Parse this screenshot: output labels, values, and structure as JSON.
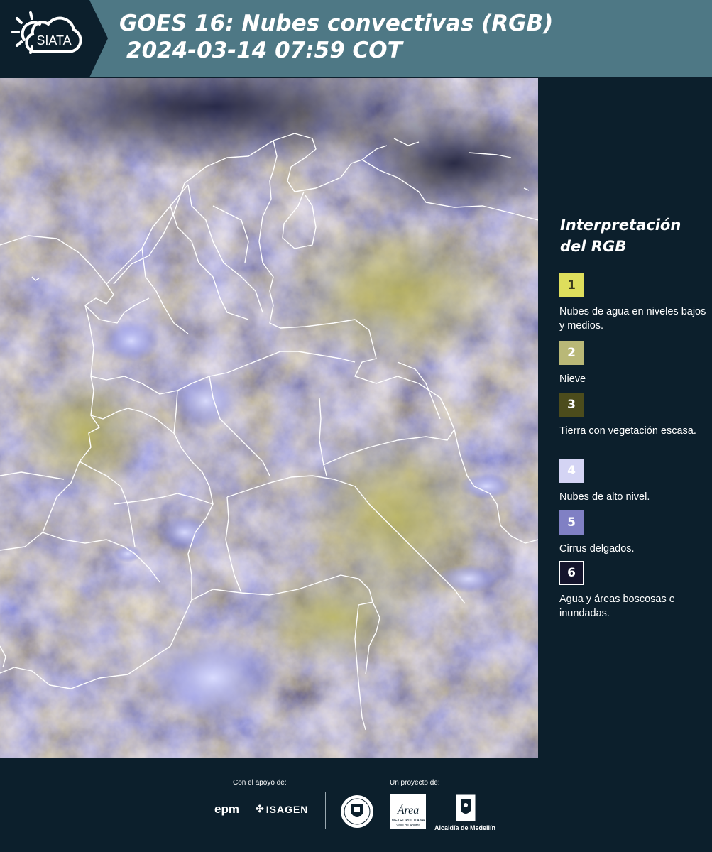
{
  "header": {
    "logo_text": "SIATA",
    "title_line1": "GOES 16: Nubes convectivas (RGB)",
    "title_line2": "2024-03-14 07:59 COT"
  },
  "legend": {
    "title": "Interpretación del RGB",
    "items": [
      {
        "number": "1",
        "label": "Nubes de agua en niveles bajos y medios.",
        "color": "#dede5c",
        "text_color": "#3a3a1c"
      },
      {
        "number": "2",
        "label": "Nieve",
        "color": "#b9b877",
        "text_color": "#ffffff"
      },
      {
        "number": "3",
        "label": "Tierra con vegetación escasa.",
        "color": "#4c4c1c",
        "text_color": "#ffffff"
      },
      {
        "number": "4",
        "label": "Nubes de alto nivel.",
        "color": "#d4d4f4",
        "text_color": "#ffffff"
      },
      {
        "number": "5",
        "label": "Cirrus delgados.",
        "color": "#8080c4",
        "text_color": "#ffffff"
      },
      {
        "number": "6",
        "label": "Agua y áreas boscosas e inundadas.",
        "color": "#14142c",
        "text_color": "#ffffff"
      }
    ]
  },
  "footer": {
    "support_label": "Con el apoyo de:",
    "project_label": "Un proyecto de:",
    "sponsors": [
      "epm",
      "ISAGEN"
    ],
    "project_logos": [
      "Medellín",
      "Área Metropolitana Valle de Aburrá",
      "Alcaldía de Medellín"
    ],
    "area_logo_text": "Área",
    "area_logo_sub": "METROPOLITANA",
    "area_logo_sub2": "Valle de Aburrá",
    "alcaldia_text": "Alcaldía de Medellín"
  }
}
